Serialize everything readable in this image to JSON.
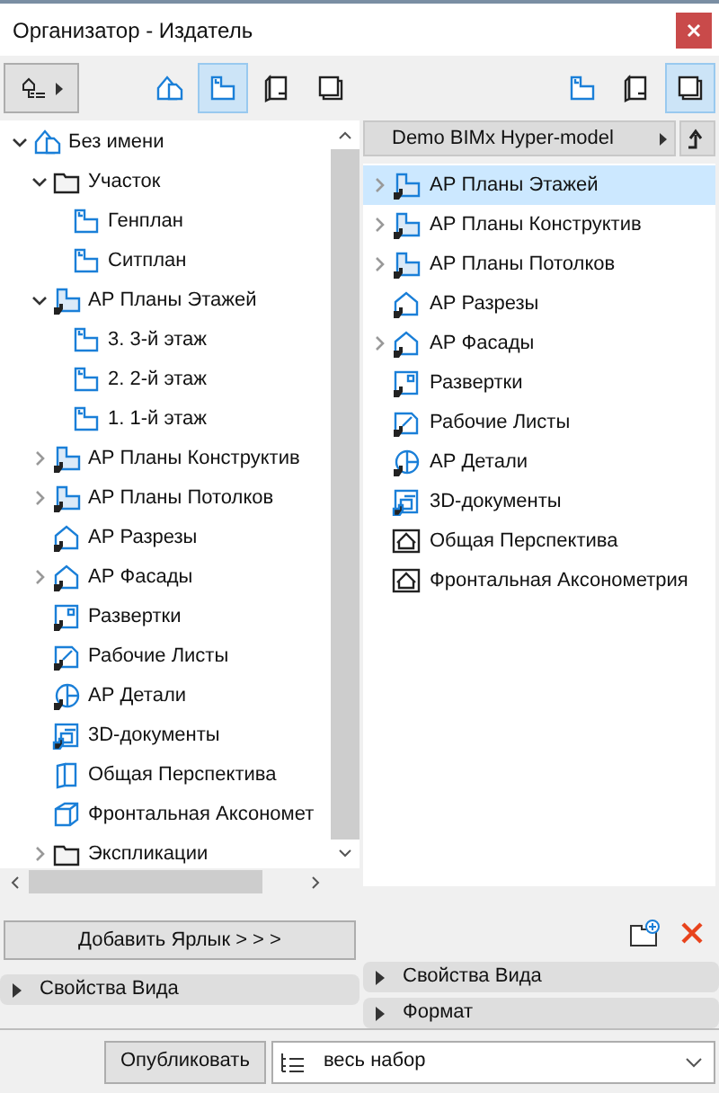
{
  "window": {
    "title": "Организатор - Издатель"
  },
  "left_panel": {
    "view_buttons": [
      {
        "kind": "project",
        "selected": false
      },
      {
        "kind": "plan",
        "selected": true
      },
      {
        "kind": "layout",
        "selected": false
      },
      {
        "kind": "sets",
        "selected": false
      }
    ],
    "tree": [
      {
        "label": "Без имени",
        "kind": "project",
        "expanded": true,
        "children": [
          {
            "label": "Участок",
            "kind": "folder",
            "expanded": true,
            "children": [
              {
                "label": "Генплан",
                "kind": "plan"
              },
              {
                "label": "Ситплан",
                "kind": "plan"
              }
            ]
          },
          {
            "label": "АР Планы Этажей",
            "kind": "plan-linked",
            "expanded": true,
            "children": [
              {
                "label": "3. 3-й этаж",
                "kind": "plan"
              },
              {
                "label": "2. 2-й этаж",
                "kind": "plan"
              },
              {
                "label": "1. 1-й этаж",
                "kind": "plan"
              }
            ]
          },
          {
            "label": "АР Планы Конструктив",
            "kind": "plan-linked",
            "expanded": false
          },
          {
            "label": "АР Планы Потолков",
            "kind": "plan-linked",
            "expanded": false
          },
          {
            "label": "АР Разрезы",
            "kind": "section"
          },
          {
            "label": "АР Фасады",
            "kind": "section",
            "expanded": false
          },
          {
            "label": "Развертки",
            "kind": "interior"
          },
          {
            "label": "Рабочие Листы",
            "kind": "worksheet"
          },
          {
            "label": "АР Детали",
            "kind": "detail"
          },
          {
            "label": "3D-документы",
            "kind": "doc3d"
          },
          {
            "label": "Общая Перспектива",
            "kind": "camera"
          },
          {
            "label": "Фронтальная Аксономет",
            "kind": "axon"
          },
          {
            "label": "Экспликации",
            "kind": "folder",
            "expanded": false
          }
        ]
      }
    ],
    "add_button": "Добавить Ярлык > > >",
    "sections": [
      {
        "label": "Свойства Вида",
        "expanded": false
      }
    ]
  },
  "right_panel": {
    "view_buttons": [
      {
        "kind": "plan",
        "selected": false
      },
      {
        "kind": "layout",
        "selected": false
      },
      {
        "kind": "sets",
        "selected": true
      }
    ],
    "path": "Demo BIMx Hyper-model",
    "items": [
      {
        "label": "АР Планы Этажей",
        "kind": "plan-linked",
        "expanded": false,
        "selected": true
      },
      {
        "label": "АР Планы Конструктив",
        "kind": "plan-linked",
        "expanded": false,
        "selected": false
      },
      {
        "label": "АР Планы Потолков",
        "kind": "plan-linked",
        "expanded": false,
        "selected": false
      },
      {
        "label": "АР Разрезы",
        "kind": "section",
        "selected": false
      },
      {
        "label": "АР Фасады",
        "kind": "section",
        "expanded": false,
        "selected": false
      },
      {
        "label": "Развертки",
        "kind": "interior",
        "selected": false
      },
      {
        "label": "Рабочие Листы",
        "kind": "worksheet",
        "selected": false
      },
      {
        "label": "АР Детали",
        "kind": "detail",
        "selected": false
      },
      {
        "label": "3D-документы",
        "kind": "doc3d",
        "selected": false
      },
      {
        "label": "Общая Перспектива",
        "kind": "house-view",
        "selected": false
      },
      {
        "label": "Фронтальная Аксонометрия",
        "kind": "house-view",
        "selected": false
      }
    ],
    "sections": [
      {
        "label": "Свойства Вида",
        "expanded": false
      },
      {
        "label": "Формат",
        "expanded": false
      }
    ]
  },
  "footer": {
    "publish_button": "Опубликовать",
    "set_select": {
      "value": "весь набор"
    }
  }
}
